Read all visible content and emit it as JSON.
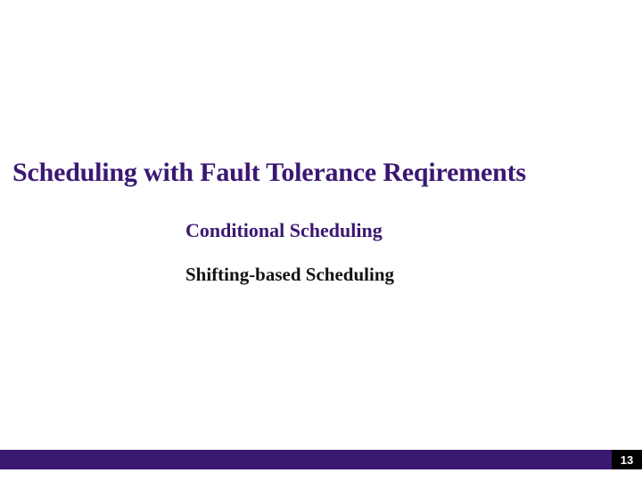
{
  "slide": {
    "title": "Scheduling with Fault Tolerance Reqirements",
    "line1": "Conditional Scheduling",
    "line2": "Shifting-based Scheduling",
    "page_number": "13"
  },
  "colors": {
    "accent": "#3b1872",
    "footer_bar": "#3b1872",
    "page_box": "#000000"
  }
}
